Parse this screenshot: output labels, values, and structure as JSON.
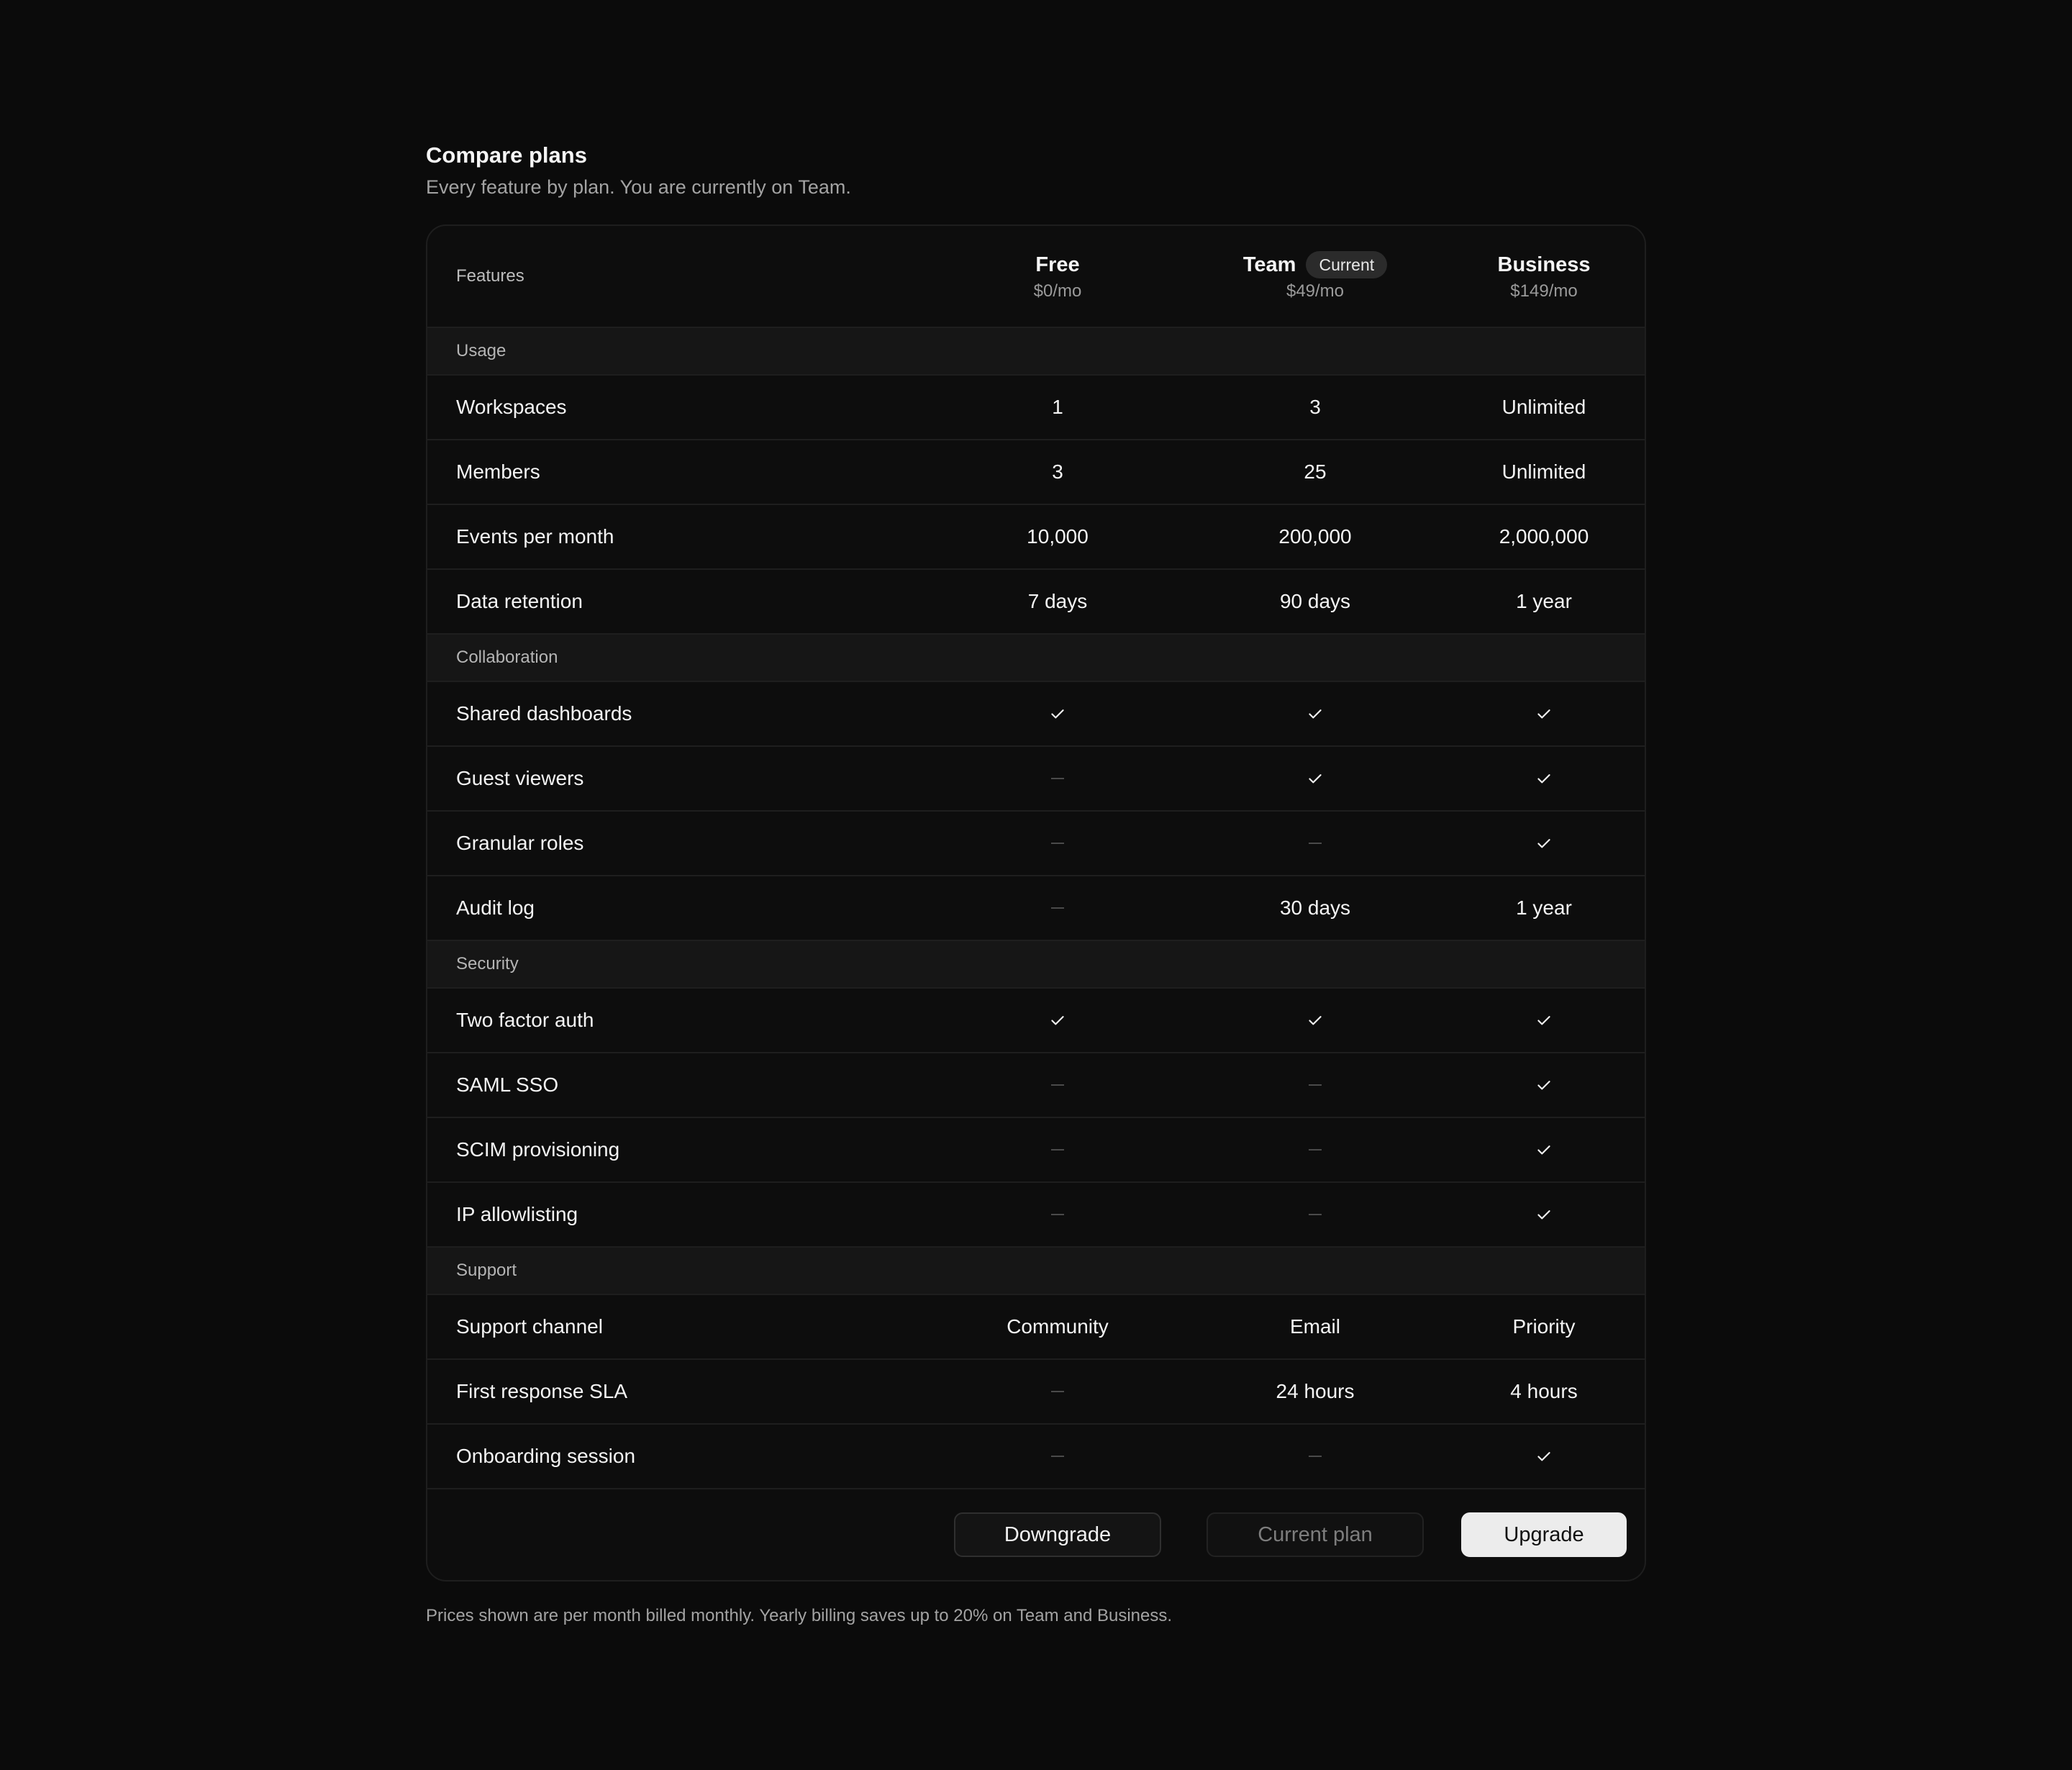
{
  "header": {
    "title": "Compare plans",
    "subtitle": "Every feature by plan. You are currently on Team."
  },
  "table": {
    "features_label": "Features",
    "plans": [
      {
        "name": "Free",
        "price": "$0/mo"
      },
      {
        "name": "Team",
        "price": "$49/mo",
        "badge": "Current"
      },
      {
        "name": "Business",
        "price": "$149/mo"
      }
    ],
    "sections": [
      {
        "name": "Usage",
        "rows": [
          {
            "feature": "Workspaces",
            "values": [
              "1",
              "3",
              "Unlimited"
            ]
          },
          {
            "feature": "Members",
            "values": [
              "3",
              "25",
              "Unlimited"
            ]
          },
          {
            "feature": "Events per month",
            "values": [
              "10,000",
              "200,000",
              "2,000,000"
            ]
          },
          {
            "feature": "Data retention",
            "values": [
              "7 days",
              "90 days",
              "1 year"
            ]
          }
        ]
      },
      {
        "name": "Collaboration",
        "rows": [
          {
            "feature": "Shared dashboards",
            "values": [
              "check",
              "check",
              "check"
            ]
          },
          {
            "feature": "Guest viewers",
            "values": [
              "dash",
              "check",
              "check"
            ]
          },
          {
            "feature": "Granular roles",
            "values": [
              "dash",
              "dash",
              "check"
            ]
          },
          {
            "feature": "Audit log",
            "values": [
              "dash",
              "30 days",
              "1 year"
            ]
          }
        ]
      },
      {
        "name": "Security",
        "rows": [
          {
            "feature": "Two factor auth",
            "values": [
              "check",
              "check",
              "check"
            ]
          },
          {
            "feature": "SAML SSO",
            "values": [
              "dash",
              "dash",
              "check"
            ]
          },
          {
            "feature": "SCIM provisioning",
            "values": [
              "dash",
              "dash",
              "check"
            ]
          },
          {
            "feature": "IP allowlisting",
            "values": [
              "dash",
              "dash",
              "check"
            ]
          }
        ]
      },
      {
        "name": "Support",
        "rows": [
          {
            "feature": "Support channel",
            "values": [
              "Community",
              "Email",
              "Priority"
            ]
          },
          {
            "feature": "First response SLA",
            "values": [
              "dash",
              "24 hours",
              "4 hours"
            ]
          },
          {
            "feature": "Onboarding session",
            "values": [
              "dash",
              "dash",
              "check"
            ]
          }
        ]
      }
    ],
    "actions": {
      "downgrade": "Downgrade",
      "current": "Current plan",
      "upgrade": "Upgrade"
    }
  },
  "footnote": "Prices shown are per month billed monthly. Yearly billing saves up to 20% on Team and Business."
}
